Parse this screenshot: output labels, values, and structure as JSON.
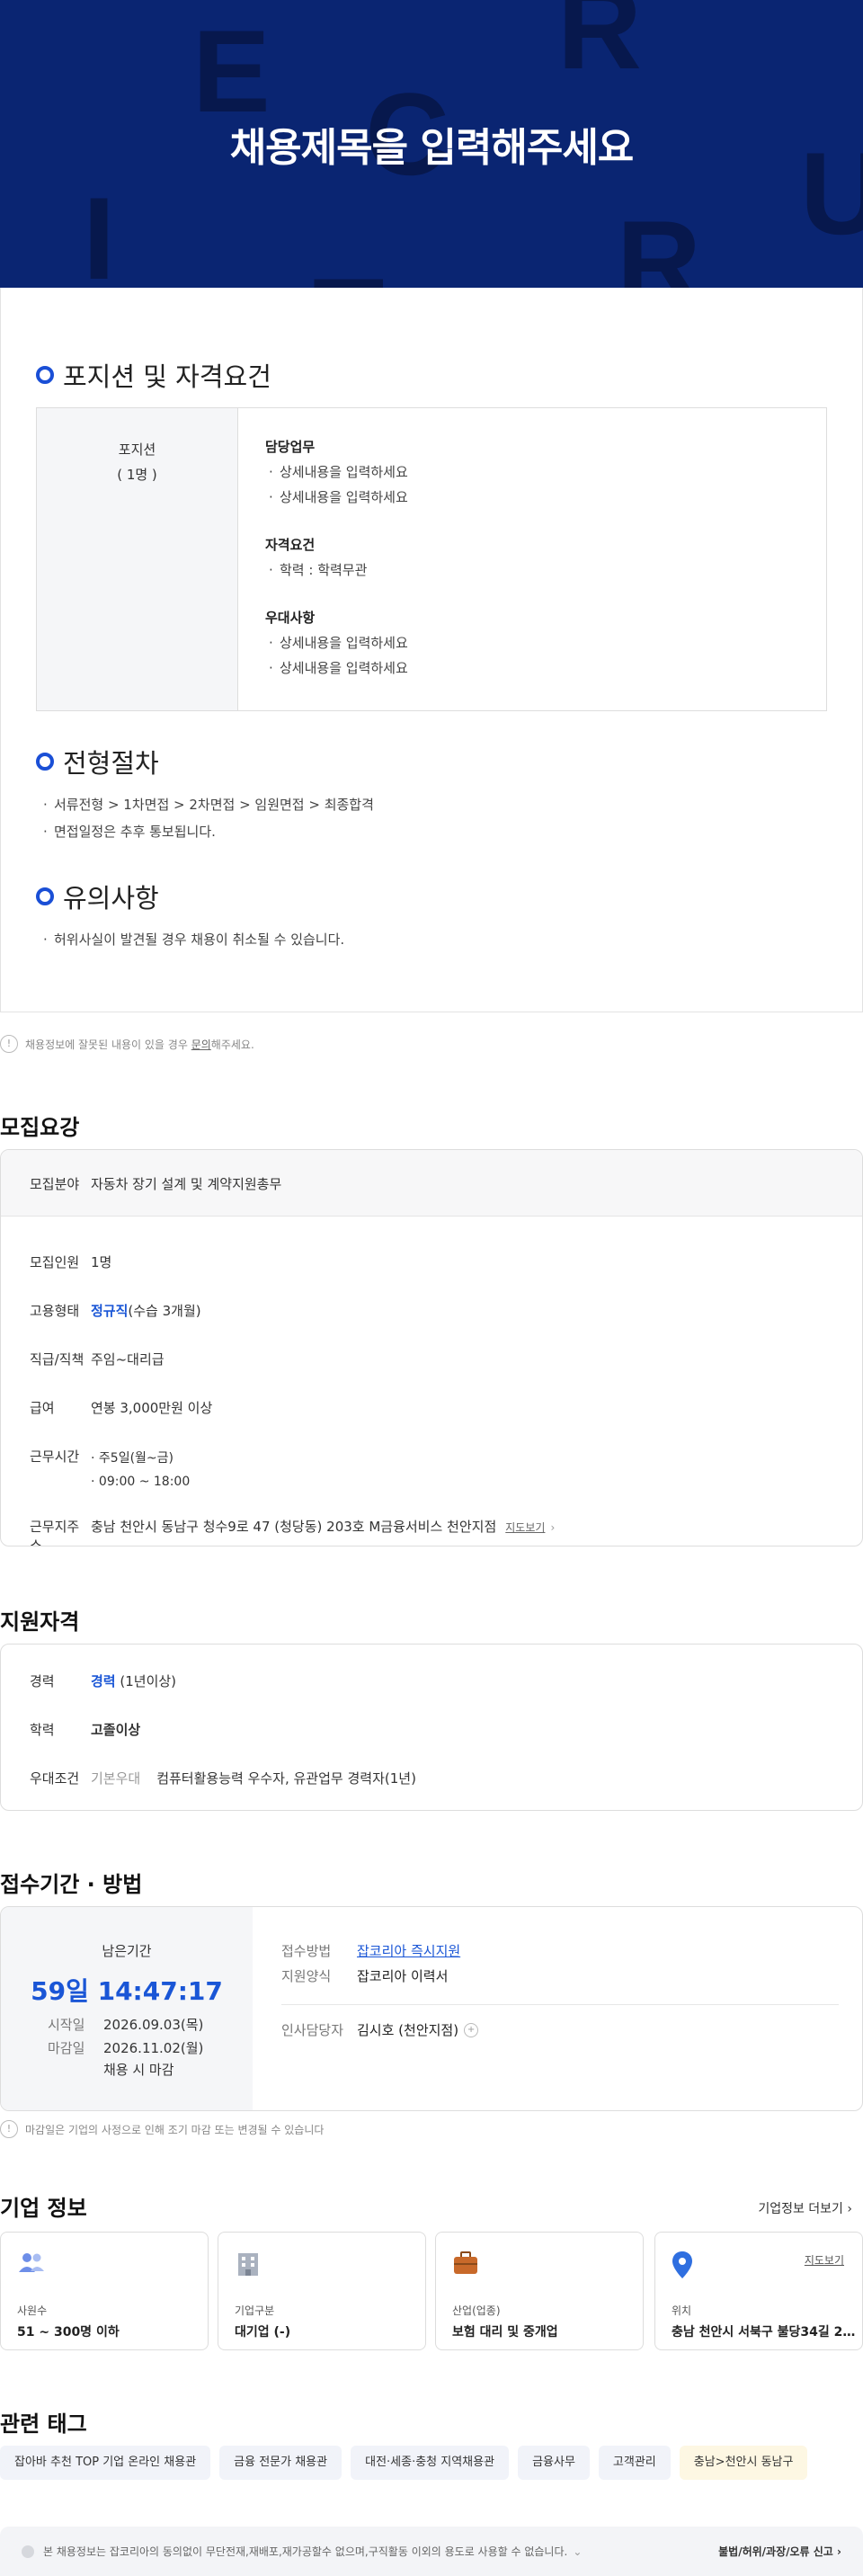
{
  "hero": {
    "title": "채용제목을 입력해주세요",
    "letters": [
      "E",
      "R",
      "C",
      "U",
      "I",
      "T",
      "R"
    ]
  },
  "detail": {
    "position_section_title": "포지션 및 자격요건",
    "position_label": "포지션",
    "position_count": "( 1명 )",
    "duties_title": "담당업무",
    "duties": [
      "상세내용을 입력하세요",
      "상세내용을 입력하세요"
    ],
    "qual_title": "자격요건",
    "quals": [
      "학력 : 학력무관"
    ],
    "pref_title": "우대사항",
    "prefs": [
      "상세내용을 입력하세요",
      "상세내용을 입력하세요"
    ],
    "process_title": "전형절차",
    "process_items": [
      "서류전형 > 1차면접 > 2차면접 > 임원면접 > 최종합격",
      "면접일정은 추후 통보됩니다."
    ],
    "caution_title": "유의사항",
    "caution_items": [
      "허위사실이 발견될 경우 채용이 취소될 수 있습니다."
    ]
  },
  "report_notice": {
    "prefix": "채용정보에 잘못된 내용이 있을 경우 ",
    "link": "문의",
    "suffix": "해주세요."
  },
  "recruit": {
    "heading": "모집요강",
    "field_label": "모집분야",
    "field_value": "자동차 장기 설계 및 계약지원총무",
    "headcount_label": "모집인원",
    "headcount_value": "1명",
    "emp_label": "고용형태",
    "emp_highlight": "정규직",
    "emp_extra": "(수습 3개월)",
    "rank_label": "직급/직책",
    "rank_value": "주임~대리급",
    "salary_label": "급여",
    "salary_value": "연봉 3,000만원 이상",
    "hours_label": "근무시간",
    "hours": [
      "주5일(월~금)",
      "09:00 ~ 18:00"
    ],
    "addr_label": "근무지주소",
    "addr_value": "충남 천안시 동남구 청수9로 47 (청당동) 203호 M금융서비스 천안지점",
    "map_link": "지도보기"
  },
  "qualify": {
    "heading": "지원자격",
    "career_label": "경력",
    "career_highlight": "경력",
    "career_extra": "(1년이상)",
    "edu_label": "학력",
    "edu_value": "고졸이상",
    "pref_label": "우대조건",
    "pref_sub": "기본우대",
    "pref_value": "컴퓨터활용능력 우수자, 유관업무 경력자(1년)"
  },
  "apply": {
    "heading": "접수기간 · 방법",
    "remain_label": "남은기간",
    "remain_value": "59일 14:47:17",
    "start_label": "시작일",
    "start_value": "2026.09.03(목)",
    "end_label": "마감일",
    "end_value": "2026.11.02(월)",
    "end_extra": "채용 시 마감",
    "method_label": "접수방법",
    "method_value": "잡코리아 즉시지원",
    "form_label": "지원양식",
    "form_value": "잡코리아 이력서",
    "hr_label": "인사담당자",
    "hr_value": "김시호 (천안지점)",
    "notice": "마감일은 기업의 사정으로 인해 조기 마감 또는 변경될 수 있습니다"
  },
  "company": {
    "heading": "기업 정보",
    "more_link": "기업정보 더보기",
    "cards": [
      {
        "icon": "people-icon",
        "label": "사원수",
        "value": "51 ~ 300명 이하"
      },
      {
        "icon": "building-icon",
        "label": "기업구분",
        "value": "대기업 (-)"
      },
      {
        "icon": "briefcase-icon",
        "label": "산업(업종)",
        "value": "보험 대리 및 중개업"
      },
      {
        "icon": "location-pin-icon",
        "label": "위치",
        "value": "충남 천안시 서북구 불당34길 2 ...",
        "link": "지도보기"
      }
    ]
  },
  "tags": {
    "heading": "관련 태그",
    "items": [
      "잡아바 추천 TOP 기업 온라인 채용관",
      "금융 전문가 채용관",
      "대전·세종·충청 지역채용관",
      "금융사무",
      "고객관리",
      "충남>천안시 동남구"
    ]
  },
  "footer": {
    "notice": "본 채용정보는 잡코리아의 동의없이 무단전재,재배포,재가공할수 없으며,구직활동 이외의 용도로 사용할 수 없습니다.",
    "report": "불법/허위/과장/오류 신고"
  },
  "colors": {
    "hero_bg": "#0a2572",
    "accent_blue": "#1a56d6",
    "section_ring": "#1a4fd6"
  }
}
